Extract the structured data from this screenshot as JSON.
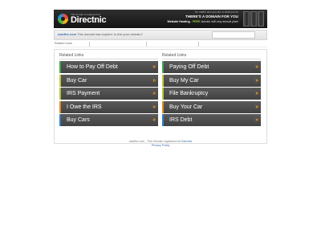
{
  "banner": {
    "logo_tagline": "This domain is registered at",
    "logo_name": "Directnic",
    "subtitle": "No matter who you are or what you do",
    "headline": "THERE'S A DOMAIN FOR YOU",
    "hosting_label": "Website Hosting",
    "hosting_free": "FREE",
    "hosting_text": "domain with any annual plan!"
  },
  "notice": {
    "domain": "owethe.com",
    "message": "This domain has expired. Is this your domain?"
  },
  "strip": {
    "label": "Related Links"
  },
  "left_column": {
    "title": "Related Links",
    "links": [
      {
        "label": "How to Pay Off Debt",
        "accent": "#3fa74a"
      },
      {
        "label": "Buy Car",
        "accent": "#c3c93b"
      },
      {
        "label": "IRS Payment",
        "accent": "#b4c43a"
      },
      {
        "label": "I Owe the IRS",
        "accent": "#e48a22"
      },
      {
        "label": "Buy Cars",
        "accent": "#2e7fc4"
      }
    ]
  },
  "right_column": {
    "title": "Related Links",
    "links": [
      {
        "label": "Paying Off Debt",
        "accent": "#3fa74a"
      },
      {
        "label": "Buy My Car",
        "accent": "#c3c93b"
      },
      {
        "label": "File Bankruptcy",
        "accent": "#b4c43a"
      },
      {
        "label": "Buy Your Car",
        "accent": "#e48a22"
      },
      {
        "label": "IRS Debt",
        "accent": "#2e7fc4"
      }
    ]
  },
  "arrow_glyph": "»",
  "footer": {
    "text_prefix": "owethe.com - This Domain registered at",
    "registrar_link": "Directnic",
    "privacy_link": "Privacy Policy"
  }
}
